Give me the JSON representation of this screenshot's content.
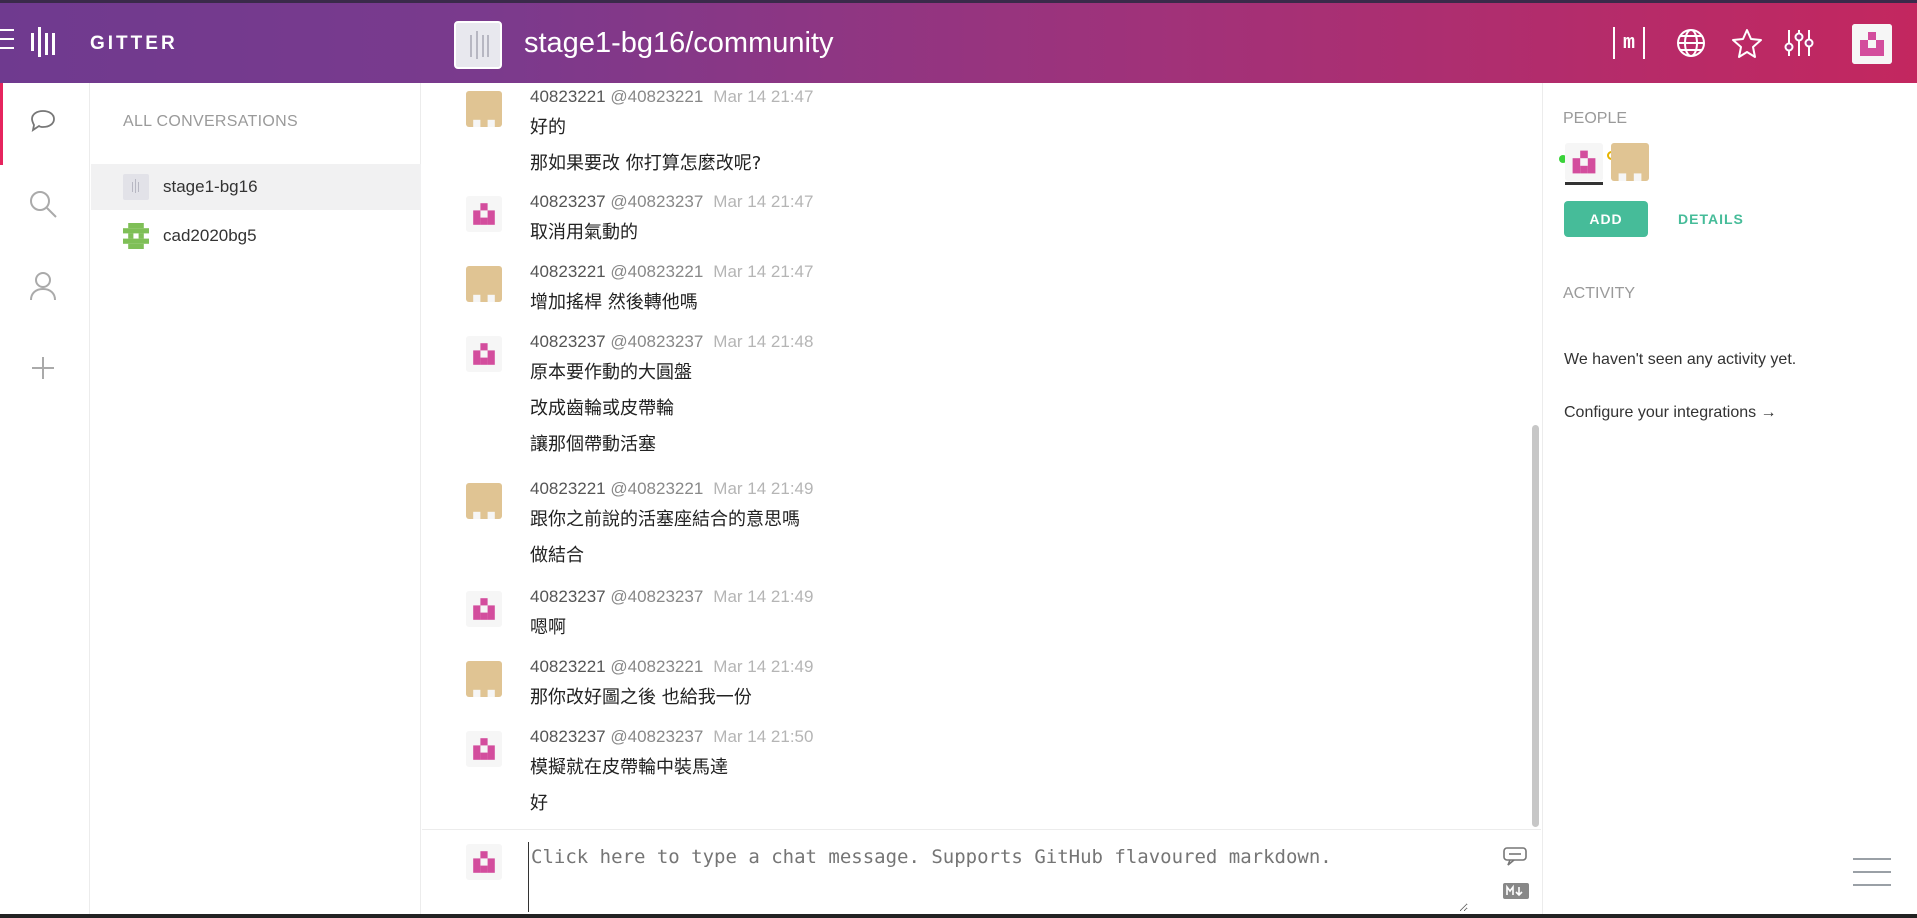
{
  "header": {
    "brand": "GITTER",
    "room_title": "stage1-bg16/community",
    "icons": [
      "matrix-icon",
      "globe-icon",
      "star-icon",
      "settings-sliders-icon"
    ],
    "matrix_label": "m"
  },
  "rail": {
    "items": [
      "chat-bubble-icon",
      "search-icon",
      "person-icon",
      "plus-icon"
    ]
  },
  "conversations": {
    "heading": "ALL CONVERSATIONS",
    "items": [
      {
        "label": "stage1-bg16",
        "active": true
      },
      {
        "label": "cad2020bg5",
        "active": false
      }
    ]
  },
  "messages": [
    {
      "name": "40823221",
      "user": "@40823221",
      "time": "Mar 14 21:47",
      "avatar": "tan",
      "lines": [
        "好的",
        "那如果要改 你打算怎麼改呢?"
      ]
    },
    {
      "name": "40823237",
      "user": "@40823237",
      "time": "Mar 14 21:47",
      "avatar": "pink",
      "lines": [
        "取消用氣動的"
      ]
    },
    {
      "name": "40823221",
      "user": "@40823221",
      "time": "Mar 14 21:47",
      "avatar": "tan",
      "lines": [
        "增加搖桿 然後轉他嗎"
      ]
    },
    {
      "name": "40823237",
      "user": "@40823237",
      "time": "Mar 14 21:48",
      "avatar": "pink",
      "lines": [
        "原本要作動的大圓盤",
        "改成齒輪或皮帶輪",
        "讓那個帶動活塞"
      ]
    },
    {
      "name": "40823221",
      "user": "@40823221",
      "time": "Mar 14 21:49",
      "avatar": "tan",
      "lines": [
        "跟你之前說的活塞座結合的意思嗎",
        "做結合"
      ]
    },
    {
      "name": "40823237",
      "user": "@40823237",
      "time": "Mar 14 21:49",
      "avatar": "pink",
      "lines": [
        "嗯啊"
      ]
    },
    {
      "name": "40823221",
      "user": "@40823221",
      "time": "Mar 14 21:49",
      "avatar": "tan",
      "lines": [
        "那你改好圖之後 也給我一份"
      ]
    },
    {
      "name": "40823237",
      "user": "@40823237",
      "time": "Mar 14 21:50",
      "avatar": "pink",
      "lines": [
        "模擬就在皮帶輪中裝馬達",
        "好"
      ]
    }
  ],
  "composer": {
    "placeholder": "Click here to type a chat message. Supports GitHub flavoured markdown."
  },
  "right_panel": {
    "people_heading": "PEOPLE",
    "add_label": "ADD",
    "details_label": "DETAILS",
    "activity_heading": "ACTIVITY",
    "activity_empty": "We haven't seen any activity yet.",
    "configure_link": "Configure your integrations →"
  },
  "colors": {
    "accent_green": "#46bc99",
    "accent_pink": "#e6245e",
    "avatar_pink": "#d34d9d",
    "avatar_tan": "#e0c493"
  }
}
